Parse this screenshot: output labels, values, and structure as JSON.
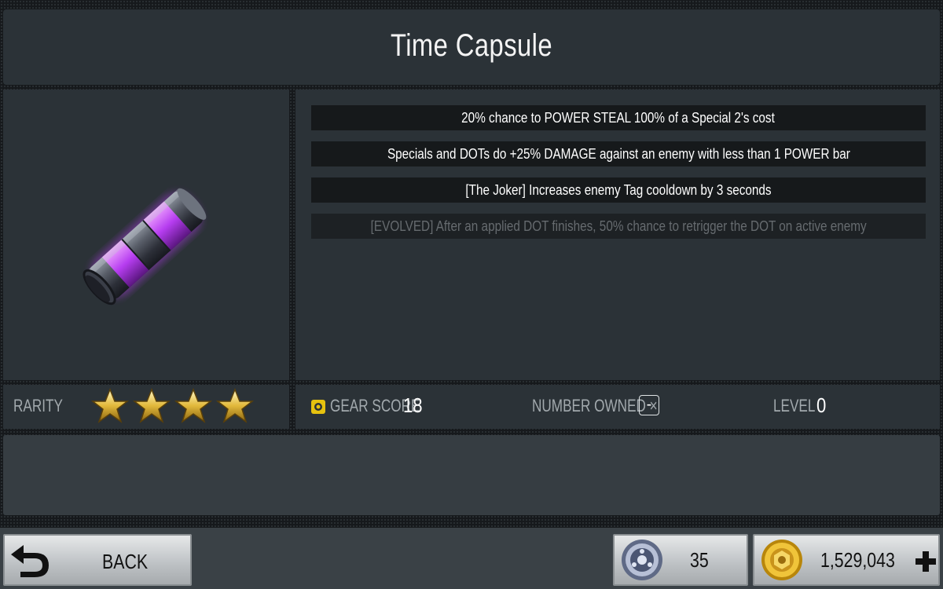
{
  "item": {
    "title": "Time Capsule"
  },
  "stats": [
    "20%  chance to POWER STEAL 100% of a Special 2's cost",
    "Specials and DOTs do +25% DAMAGE against an enemy with less than 1 POWER bar",
    "[The Joker] Increases enemy Tag cooldown by 3 seconds",
    "[EVOLVED] After an applied DOT finishes, 50% chance to retrigger the DOT on active enemy"
  ],
  "rarity": {
    "label": "RARITY",
    "stars": 4
  },
  "info": {
    "gear_score_label": "GEAR SCORE",
    "gear_score_value": "18",
    "number_owned_label": "NUMBER OWNED ×",
    "number_owned_value": "-",
    "level_label": "LEVEL",
    "level_value": "0"
  },
  "bottom": {
    "back_label": "BACK",
    "tokens_value": "35",
    "credits_value": "1,529,043"
  },
  "colors": {
    "capsule_glow": "#c04cff",
    "gold": "#e2b93b",
    "gear_icon": "#e6c20f"
  },
  "icons": [
    "gear-score-icon",
    "back-arrow-icon",
    "token-icon",
    "credits-icon",
    "plus-icon",
    "star-icon",
    "time-capsule-icon"
  ]
}
